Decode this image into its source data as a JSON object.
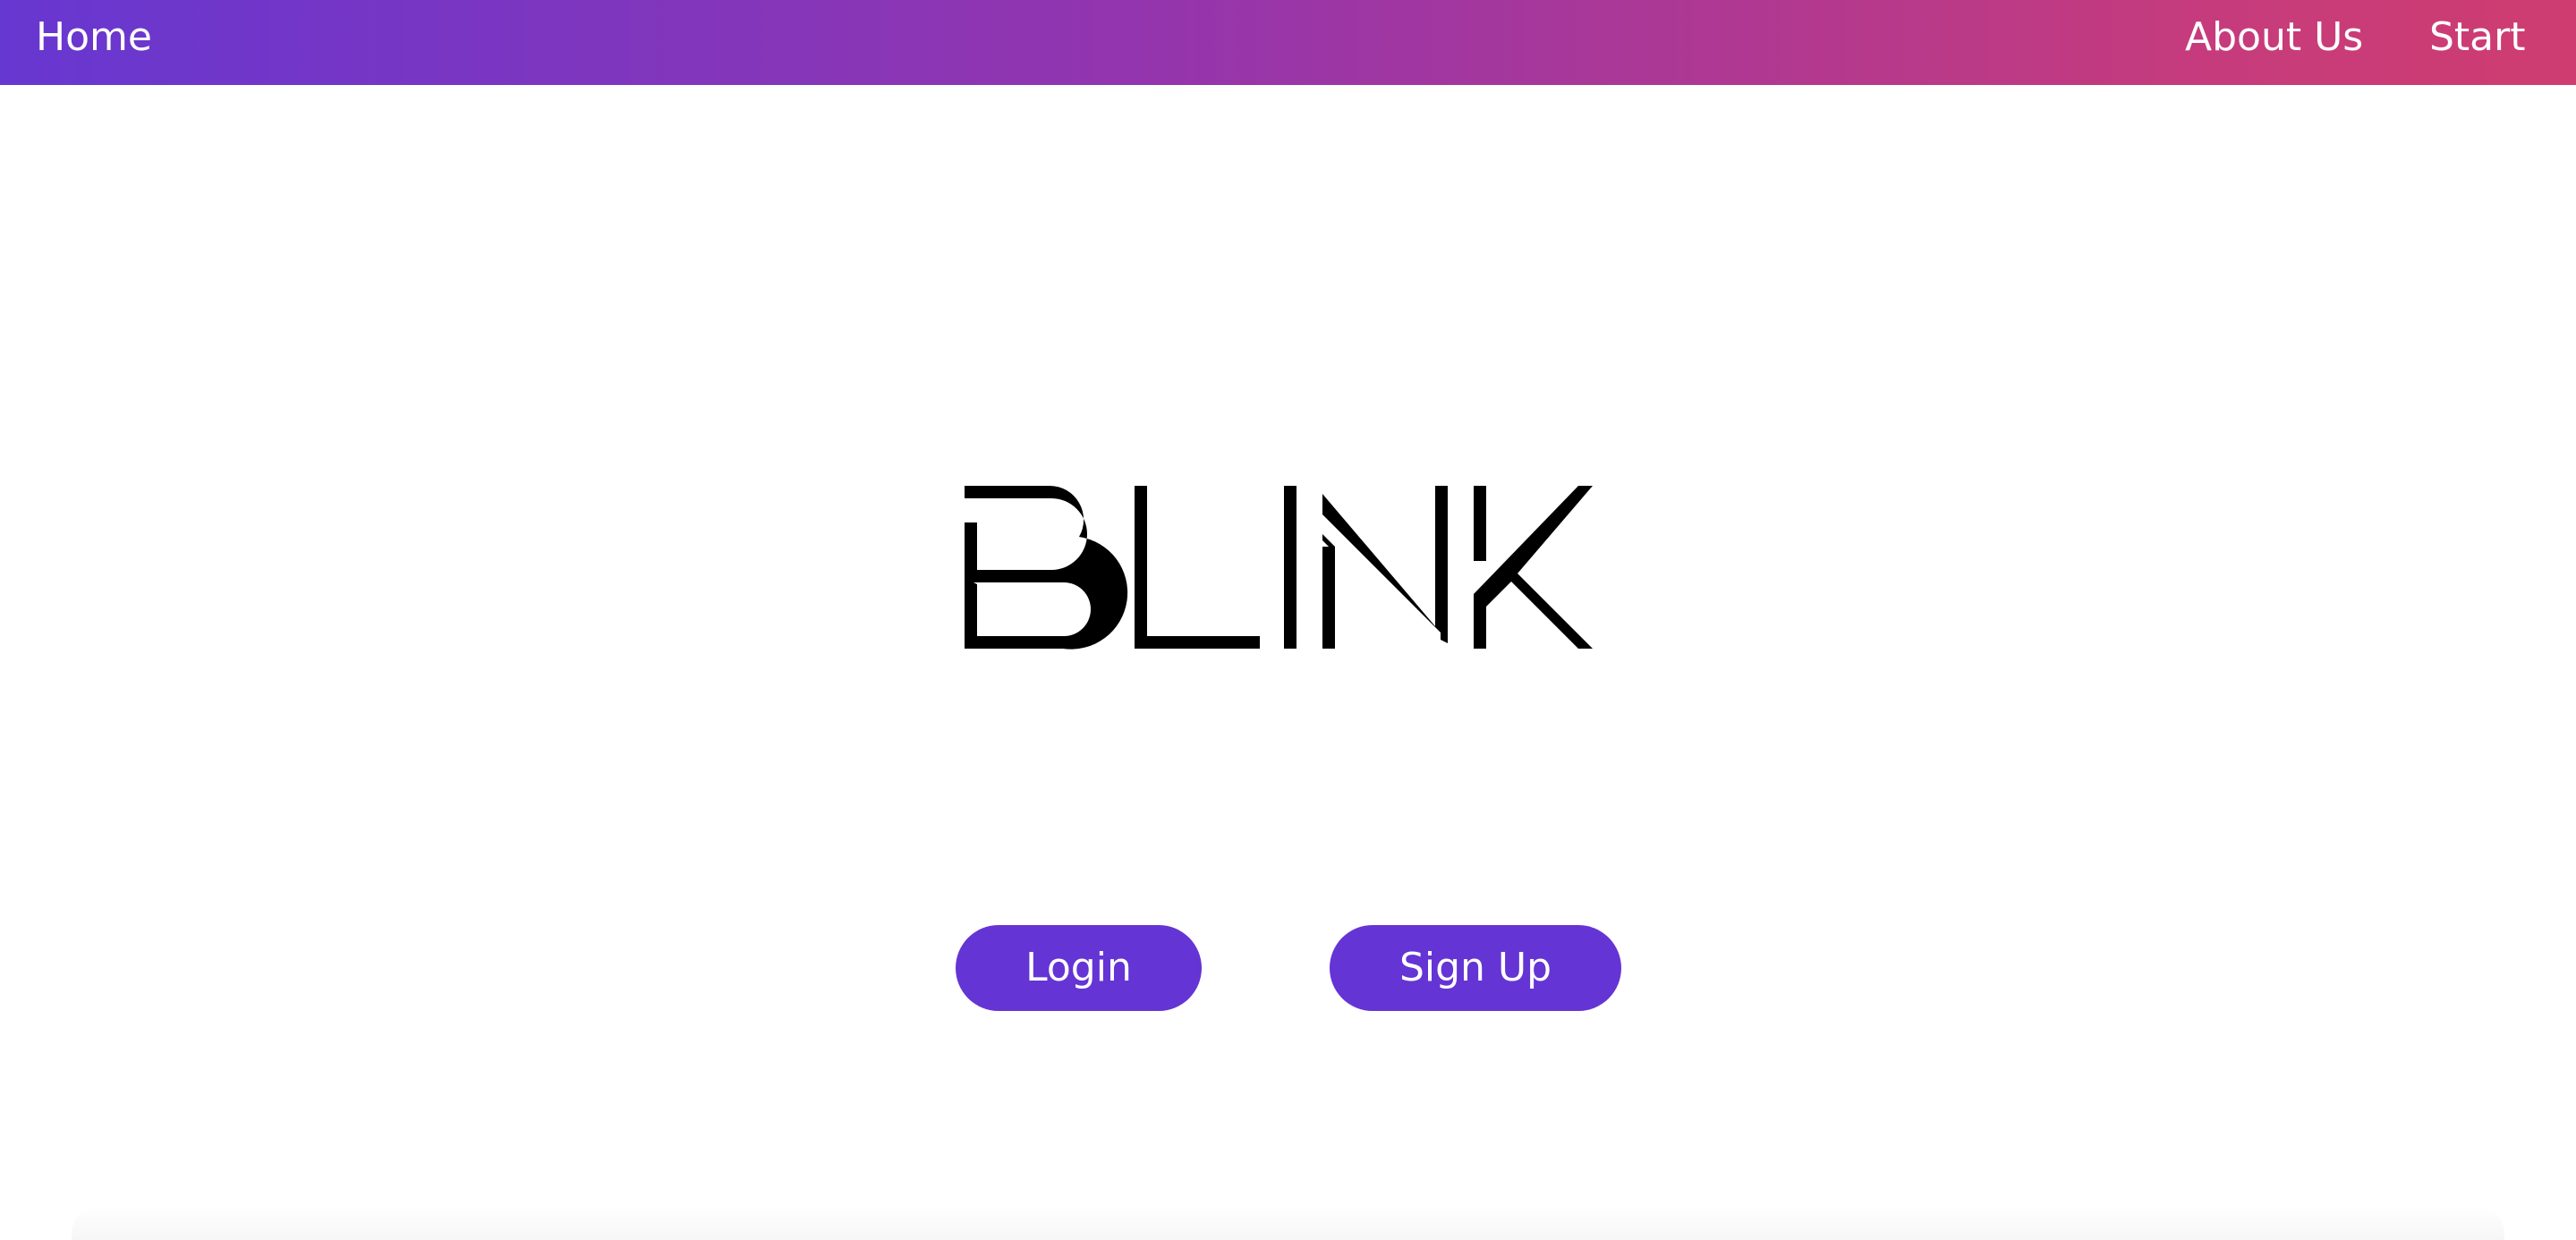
{
  "navbar": {
    "home_label": "Home",
    "about_label": "About Us",
    "start_label": "Start",
    "gradient_start": "#6737d1",
    "gradient_end": "#cf3d70"
  },
  "hero": {
    "logo_text": "BLINK"
  },
  "actions": {
    "login_label": "Login",
    "signup_label": "Sign Up",
    "button_color": "#6534d4"
  }
}
